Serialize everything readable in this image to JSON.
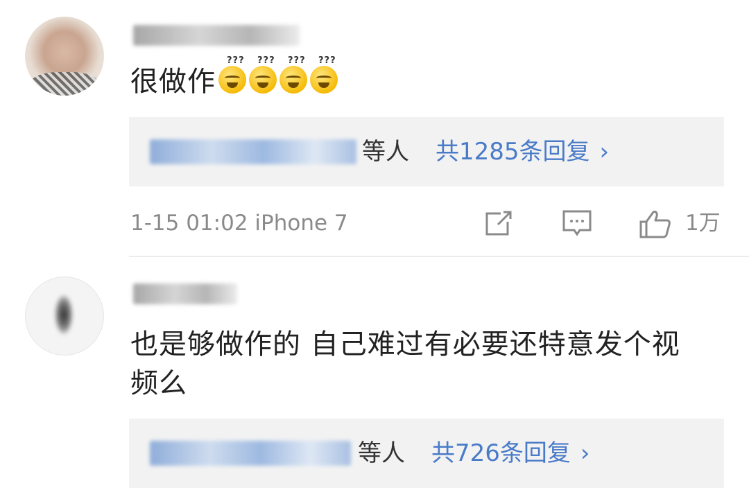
{
  "comments": [
    {
      "text": "很做作",
      "emoji_count": 4,
      "emoji_icon": "dizzy-grin-emoji",
      "replies": {
        "suffix": "等人",
        "count_text": "共1285条回复",
        "chevron": "›"
      },
      "meta": {
        "datetime": "1-15 01:02",
        "device": "iPhone 7"
      },
      "actions": {
        "like_count": "1万"
      }
    },
    {
      "text": "也是够做作的 自己难过有必要还特意发个视频么",
      "replies": {
        "suffix": "等人",
        "count_text": "共726条回复",
        "chevron": "›"
      }
    }
  ],
  "colors": {
    "link": "#4a7bc8",
    "meta": "#8a8a8a",
    "reply_bg": "#f2f2f2"
  }
}
